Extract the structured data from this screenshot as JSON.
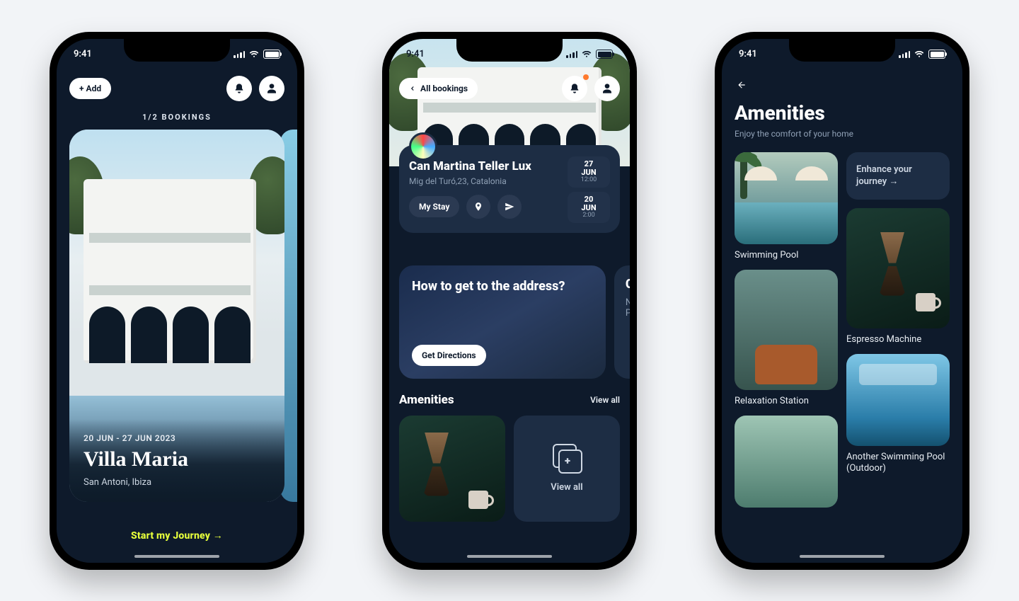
{
  "status": {
    "time": "9:41"
  },
  "phone1": {
    "add_label": "+ Add",
    "bookings_count": "1/2 BOOKINGS",
    "dates": "20 JUN - 27 JUN 2023",
    "title": "Villa Maria",
    "location": "San Antoni, Ibiza",
    "cta": "Start my Journey →"
  },
  "phone2": {
    "back_label": "All bookings",
    "name": "Can Martina Teller Lux",
    "address": "Mig del Turó,23, Catalonia",
    "stay_label": "My Stay",
    "checkin": {
      "day": "27",
      "month": "JUN",
      "time": "12:00"
    },
    "checkout": {
      "day": "20",
      "month": "JUN",
      "time": "2:00"
    },
    "directions_title": "How to get to the address?",
    "directions_btn": "Get Directions",
    "peek_line1": "N",
    "peek_line2": "Pa",
    "amen_heading": "Amenities",
    "view_all": "View all"
  },
  "phone3": {
    "title": "Amenities",
    "subtitle": "Enjoy the comfort of your home",
    "enhance": "Enhance your journey  →",
    "items": [
      "Swimming Pool",
      "Espresso Machine",
      "Relaxation Station",
      "Another Swimming Pool (Outdoor)"
    ]
  }
}
